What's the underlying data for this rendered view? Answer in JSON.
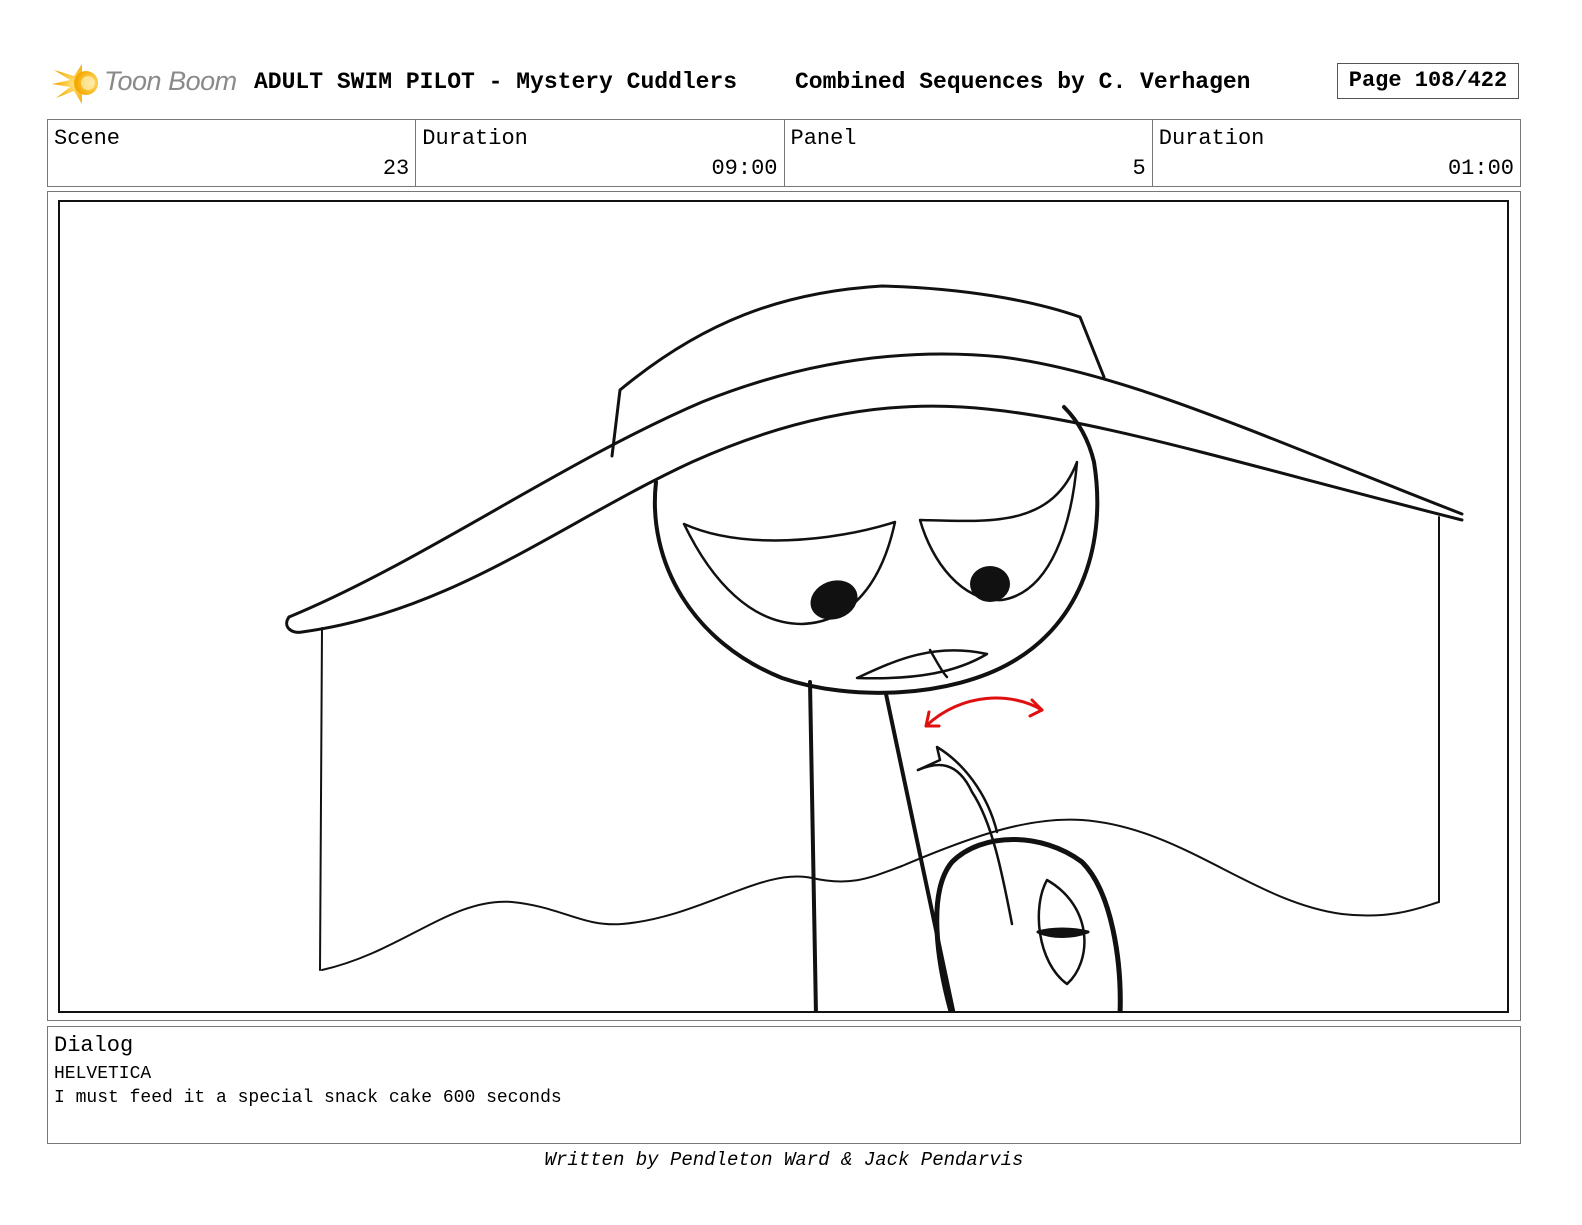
{
  "header": {
    "logo_text": "Toon Boom",
    "title": "ADULT SWIM PILOT - Mystery Cuddlers",
    "subtitle": "Combined Sequences by C. Verhagen",
    "page_label": "Page 108/422"
  },
  "info": {
    "scene_label": "Scene",
    "scene_value": "23",
    "scene_duration_label": "Duration",
    "scene_duration_value": "09:00",
    "panel_label": "Panel",
    "panel_value": "5",
    "panel_duration_label": "Duration",
    "panel_duration_value": "01:00"
  },
  "dialog": {
    "label": "Dialog",
    "speaker": "HELVETICA",
    "line": "I must feed it a special snack cake 600 seconds"
  },
  "footer": {
    "credit": "Written by Pendleton Ward & Jack Pendarvis"
  },
  "colors": {
    "logo_accent": "#f5b700",
    "motion_arrow": "#e01010"
  }
}
